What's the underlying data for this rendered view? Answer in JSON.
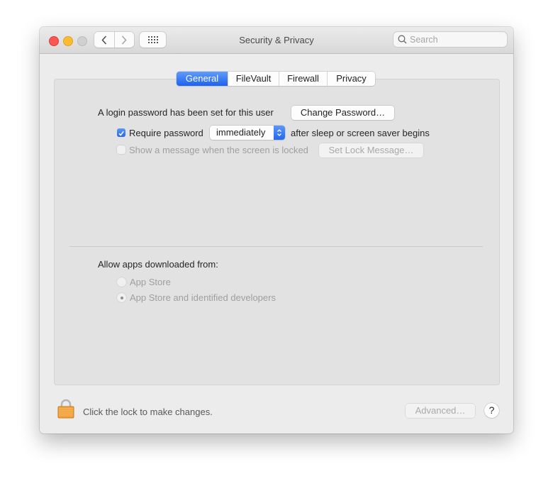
{
  "window": {
    "title": "Security & Privacy",
    "search_placeholder": "Search",
    "nav": {
      "back_icon": "chevron-left-icon",
      "forward_icon": "chevron-right-icon",
      "grid_icon": "show-all-grid-icon"
    }
  },
  "tabs": [
    {
      "label": "General",
      "active": true
    },
    {
      "label": "FileVault",
      "active": false
    },
    {
      "label": "Firewall",
      "active": false
    },
    {
      "label": "Privacy",
      "active": false
    }
  ],
  "general": {
    "login_password_text": "A login password has been set for this user",
    "change_password_button": "Change Password…",
    "require_password": {
      "checked": true,
      "label": "Require password",
      "selected_option": "immediately",
      "suffix": "after sleep or screen saver begins"
    },
    "show_message": {
      "checked": false,
      "enabled": false,
      "label": "Show a message when the screen is locked",
      "button": "Set Lock Message…"
    },
    "allow_apps": {
      "heading": "Allow apps downloaded from:",
      "options": [
        {
          "label": "App Store",
          "selected": false
        },
        {
          "label": "App Store and identified developers",
          "selected": true
        }
      ]
    }
  },
  "footer": {
    "lock_text": "Click the lock to make changes.",
    "advanced_button": "Advanced…",
    "help_label": "?",
    "lock_color": "#f0a030"
  },
  "colors": {
    "accent": "#2468ef",
    "traffic_close": "#fc5753",
    "traffic_min": "#fdbc2f"
  }
}
